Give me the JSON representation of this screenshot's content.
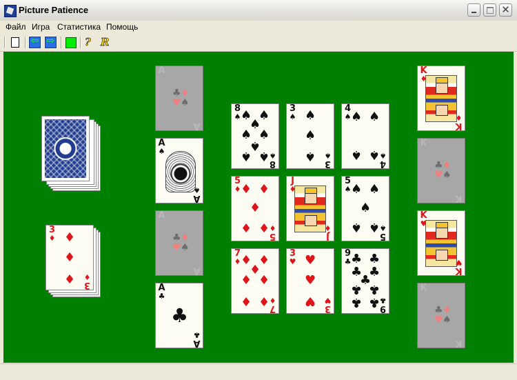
{
  "window": {
    "title": "Picture Patience"
  },
  "menu": [
    "Файл",
    "Игра",
    "Статистика",
    "Помощь"
  ],
  "toolbar": {
    "new_icon": "new-document-icon",
    "undo_glyph": "⇦",
    "redo_glyph": "⇨",
    "green_icon": "green-square-icon",
    "help_glyph": "?",
    "replay_glyph": "R"
  },
  "colors": {
    "felt": "#008000",
    "red": "#e0151b",
    "black": "#111111"
  },
  "stock": {
    "label": "deck"
  },
  "waste": {
    "rank": "3",
    "suit": "♦"
  },
  "aces_column": [
    {
      "rank": "A",
      "suit": "♣",
      "state": "placeholder"
    },
    {
      "rank": "A",
      "suit": "♠",
      "state": "card"
    },
    {
      "rank": "A",
      "suit": "♣",
      "state": "placeholder"
    },
    {
      "rank": "A",
      "suit": "♣",
      "state": "card"
    }
  ],
  "tableau": [
    [
      {
        "rank": "8",
        "suit": "♠"
      },
      {
        "rank": "3",
        "suit": "♠"
      },
      {
        "rank": "4",
        "suit": "♠"
      }
    ],
    [
      {
        "rank": "5",
        "suit": "♦"
      },
      {
        "rank": "J",
        "suit": "♦"
      },
      {
        "rank": "5",
        "suit": "♠"
      }
    ],
    [
      {
        "rank": "7",
        "suit": "♦"
      },
      {
        "rank": "3",
        "suit": "♥"
      },
      {
        "rank": "9",
        "suit": "♣"
      }
    ]
  ],
  "kings_column": [
    {
      "rank": "K",
      "suit": "♦",
      "state": "card"
    },
    {
      "rank": "K",
      "suit": "♣",
      "state": "placeholder"
    },
    {
      "rank": "K",
      "suit": "♥",
      "state": "card"
    },
    {
      "rank": "K",
      "suit": "♣",
      "state": "placeholder"
    }
  ]
}
